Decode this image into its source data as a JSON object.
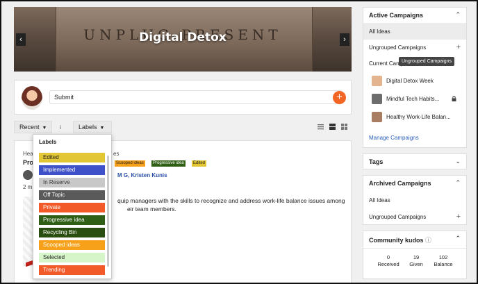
{
  "banner": {
    "engraved_text": "UNPLUG  PRESENT",
    "title": "Digital Detox",
    "prev_icon": "chevron-left-icon",
    "next_icon": "chevron-right-icon"
  },
  "submit": {
    "label": "Submit",
    "plus": "+"
  },
  "toolbar": {
    "sort_label": "Recent",
    "labels_button": "Labels",
    "sort_direction_icon": "arrow-down-icon"
  },
  "idea": {
    "partial_head": "Hea",
    "partial_pro": "Pro",
    "partial_cat": "es",
    "partial_date": "2 m",
    "tags": [
      "Scooped ideas",
      "Progressive idea",
      "Edited"
    ],
    "authors": "M G, Kristen Kunis",
    "body_line1": "quip managers with the skills to recognize and address work-life balance issues among",
    "body_line2": "eir team members."
  },
  "labels_menu": {
    "heading": "Labels",
    "items": [
      {
        "label": "Edited",
        "color": "#e2c634",
        "text": "#222222"
      },
      {
        "label": "Implemented",
        "color": "#3f51c8",
        "text": "#ffffff"
      },
      {
        "label": "In Reserve",
        "color": "#c8c8c8",
        "text": "#333333"
      },
      {
        "label": "Off Topic",
        "color": "#5a5a5a",
        "text": "#ffffff"
      },
      {
        "label": "Private",
        "color": "#f25a2a",
        "text": "#ffffff"
      },
      {
        "label": "Progressive idea",
        "color": "#2f5e15",
        "text": "#ffffff"
      },
      {
        "label": "Recycling Bin",
        "color": "#2a4d10",
        "text": "#ffffff"
      },
      {
        "label": "Scooped ideas",
        "color": "#f7a11a",
        "text": "#ffffff"
      },
      {
        "label": "Selected",
        "color": "#d6f5c9",
        "text": "#222222"
      },
      {
        "label": "Trending",
        "color": "#f25a2a",
        "text": "#ffffff"
      }
    ]
  },
  "active_campaigns": {
    "title": "Active Campaigns",
    "all_ideas": "All Ideas",
    "ungrouped": "Ungrouped Campaigns",
    "tooltip": "Ungrouped Campaigns",
    "current_partial": "Current Campa",
    "campaigns": [
      {
        "name": "Digital Detox Week",
        "thumb": "#e4b48f"
      },
      {
        "name": "Mindful Tech Habits...",
        "thumb": "#6d6d6d",
        "locked": true
      },
      {
        "name": "Healthy Work-Life Balan...",
        "thumb": "#a87d62"
      }
    ],
    "manage": "Manage Campaigns"
  },
  "tags": {
    "title": "Tags"
  },
  "archived": {
    "title": "Archived Campaigns",
    "all_ideas": "All Ideas",
    "ungrouped": "Ungrouped Campaigns"
  },
  "kudos": {
    "title": "Community kudos",
    "received_value": "0",
    "received_label": "Received",
    "given_value": "19",
    "given_label": "Given",
    "balance_value": "102",
    "balance_label": "Balance"
  }
}
